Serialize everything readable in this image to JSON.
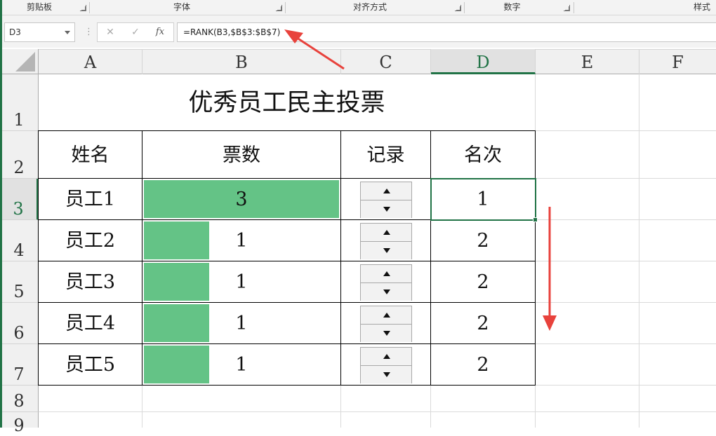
{
  "ribbon": {
    "groups": [
      "剪贴板",
      "字体",
      "对齐方式",
      "数字",
      "样式"
    ]
  },
  "formula_bar": {
    "name_box": "D3",
    "dots": "⋮",
    "cancel_symbol": "✕",
    "enter_symbol": "✓",
    "fx_label": "fx",
    "formula": "=RANK(B3,$B$3:$B$7)"
  },
  "columns": [
    "A",
    "B",
    "C",
    "D",
    "E",
    "F"
  ],
  "rows": [
    "1",
    "2",
    "3",
    "4",
    "5",
    "6",
    "7",
    "8",
    "9"
  ],
  "sheet": {
    "title": "优秀员工民主投票",
    "headers": {
      "name": "姓名",
      "votes": "票数",
      "record": "记录",
      "rank": "名次"
    },
    "records": [
      {
        "name": "员工1",
        "votes": "3",
        "rank": "1",
        "bar_fraction": 1.0
      },
      {
        "name": "员工2",
        "votes": "1",
        "rank": "2",
        "bar_fraction": 0.333
      },
      {
        "name": "员工3",
        "votes": "1",
        "rank": "2",
        "bar_fraction": 0.333
      },
      {
        "name": "员工4",
        "votes": "1",
        "rank": "2",
        "bar_fraction": 0.333
      },
      {
        "name": "员工5",
        "votes": "1",
        "rank": "2",
        "bar_fraction": 0.333
      }
    ]
  },
  "colors": {
    "data_bar": "#64c386",
    "selection": "#217346",
    "annotation_arrow": "#e8423c"
  }
}
